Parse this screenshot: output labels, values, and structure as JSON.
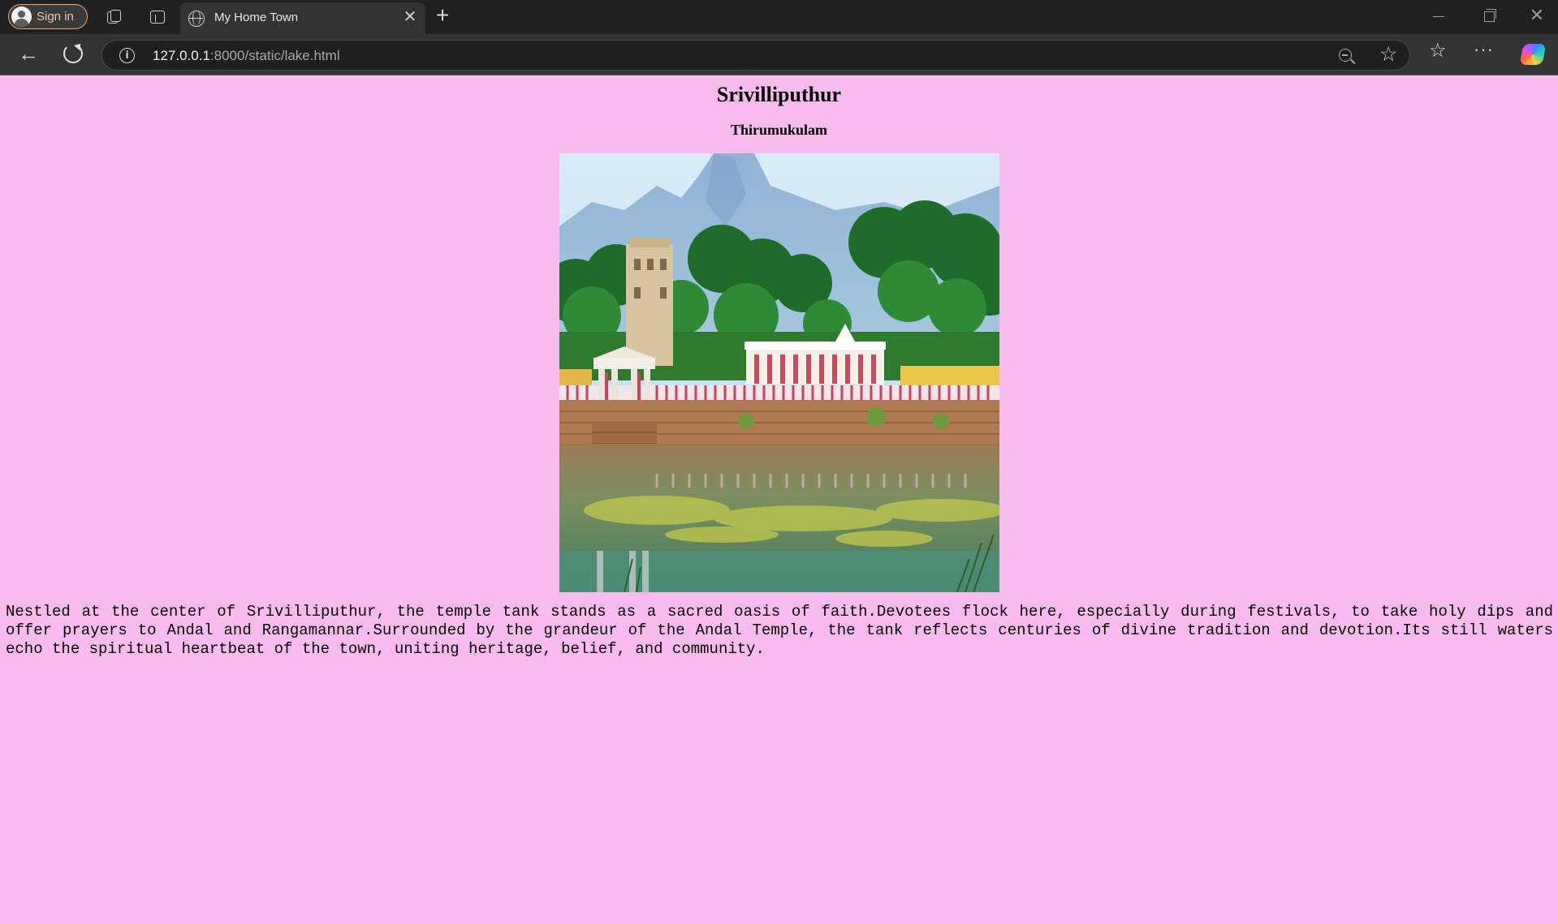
{
  "browser": {
    "signin_label": "Sign in",
    "tab_title": "My Home Town",
    "url_host": "127.0.0.1",
    "url_rest": ":8000/static/lake.html"
  },
  "page": {
    "heading": "Srivilliputhur",
    "subheading": "Thirumukulam",
    "description": "Nestled at the center of Srivilliputhur, the temple tank stands as a sacred oasis of faith.Devotees flock here, especially during festivals, to take holy dips and offer prayers to Andal and Rangamannar.Surrounded by the grandeur of the Andal Temple, the tank reflects centuries of divine tradition and devotion.Its still waters echo the spiritual heartbeat of the town, uniting heritage, belief, and community.",
    "background_color": "#f7bbee"
  },
  "icons": {
    "workspaces": "workspaces-icon",
    "tab_actions": "tab-actions-icon",
    "site": "globe-icon",
    "close_tab": "close-icon",
    "new_tab": "plus-icon",
    "back": "back-arrow-icon",
    "reload": "reload-icon",
    "info": "info-icon",
    "zoom": "zoom-out-icon",
    "favorite": "star-icon",
    "favorites": "favorites-icon",
    "more": "more-icon",
    "copilot": "copilot-icon"
  }
}
